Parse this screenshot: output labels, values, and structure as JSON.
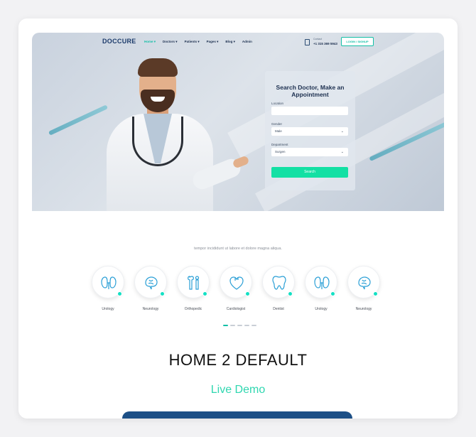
{
  "preview": {
    "logo_main": "DOCCURE",
    "menu": [
      {
        "label": "Home",
        "active": true
      },
      {
        "label": "Doctors",
        "active": false
      },
      {
        "label": "Patients",
        "active": false
      },
      {
        "label": "Pages",
        "active": false
      },
      {
        "label": "Blog",
        "active": false
      },
      {
        "label": "Admin",
        "active": false
      }
    ],
    "contact_label": "Contact",
    "contact_phone": "+1 315 369 5943",
    "login_label": "LOGIN / SIGNUP",
    "search": {
      "title": "Search Doctor, Make an Appointment",
      "location_label": "Location",
      "location_value": "",
      "gender_label": "Gender",
      "gender_value": "Male",
      "department_label": "Department",
      "department_value": "Surgen",
      "button_label": "Search"
    }
  },
  "tagline": "tempor incididunt ut labore et dolore magna aliqua.",
  "categories": [
    {
      "label": "Urology",
      "icon": "kidney-icon"
    },
    {
      "label": "Neurology",
      "icon": "brain-icon"
    },
    {
      "label": "Orthopedic",
      "icon": "bone-icon"
    },
    {
      "label": "Cardiologist",
      "icon": "heart-icon"
    },
    {
      "label": "Dentist",
      "icon": "tooth-icon"
    },
    {
      "label": "Urology",
      "icon": "kidney-icon"
    },
    {
      "label": "Neurology",
      "icon": "brain-icon"
    }
  ],
  "demo": {
    "title": "HOME 2 DEFAULT",
    "link": "Live Demo"
  },
  "colors": {
    "accent": "#13bfa6",
    "button_green": "#13e0a4",
    "navy": "#1c4f86"
  }
}
